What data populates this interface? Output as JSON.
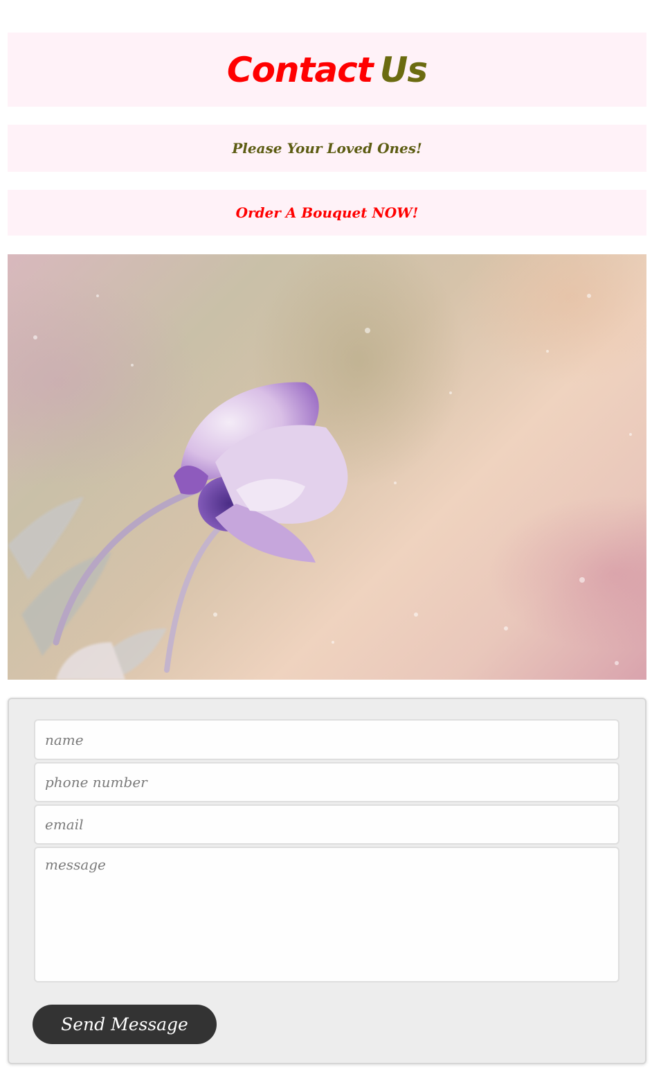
{
  "header": {
    "title_part1": "Contact",
    "title_part2": "Us",
    "tagline": "Please Your Loved Ones!",
    "call_to_action": "Order A Bouquet NOW!"
  },
  "hero": {
    "image": "flower-image",
    "colors": {
      "petal": "#c9a4df",
      "petal_dark": "#7a4fb0",
      "stem": "#b3a3c0"
    }
  },
  "form": {
    "name_placeholder": "name",
    "phone_placeholder": "phone number",
    "email_placeholder": "email",
    "message_placeholder": "message",
    "submit_label": "Send Message"
  },
  "colors": {
    "accent_red": "#ff0000",
    "accent_olive": "#6b6b10",
    "band_background": "#fff2f8",
    "button_background": "#333333"
  }
}
